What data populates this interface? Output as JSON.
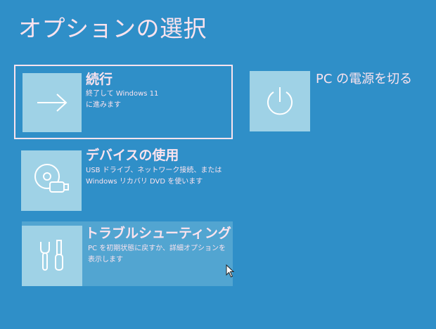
{
  "screen": {
    "title": "オプションの選択"
  },
  "options": [
    {
      "id": "continue",
      "label": "続行",
      "description_lines": [
        "終了して Windows 11",
        "に進みます"
      ],
      "icon": "arrow-right-icon"
    },
    {
      "id": "use-device",
      "label": "デバイスの使用",
      "description_lines": [
        "USB ドライブ、ネットワーク接続、または",
        "Windows リカバリ DVD を使います"
      ],
      "icon": "disc-usb-icon"
    },
    {
      "id": "troubleshoot",
      "label": "トラブルシューティング",
      "description_lines": [
        "PC を初期状態に戻すか、詳細オプションを",
        "表示します"
      ],
      "icon": "tools-icon"
    },
    {
      "id": "power-off",
      "label": "PC の電源を切る",
      "icon": "power-icon"
    }
  ],
  "colors": {
    "background": "#2f8fc8",
    "tile": "#9fd2e6",
    "text": "#fbe3ee"
  }
}
